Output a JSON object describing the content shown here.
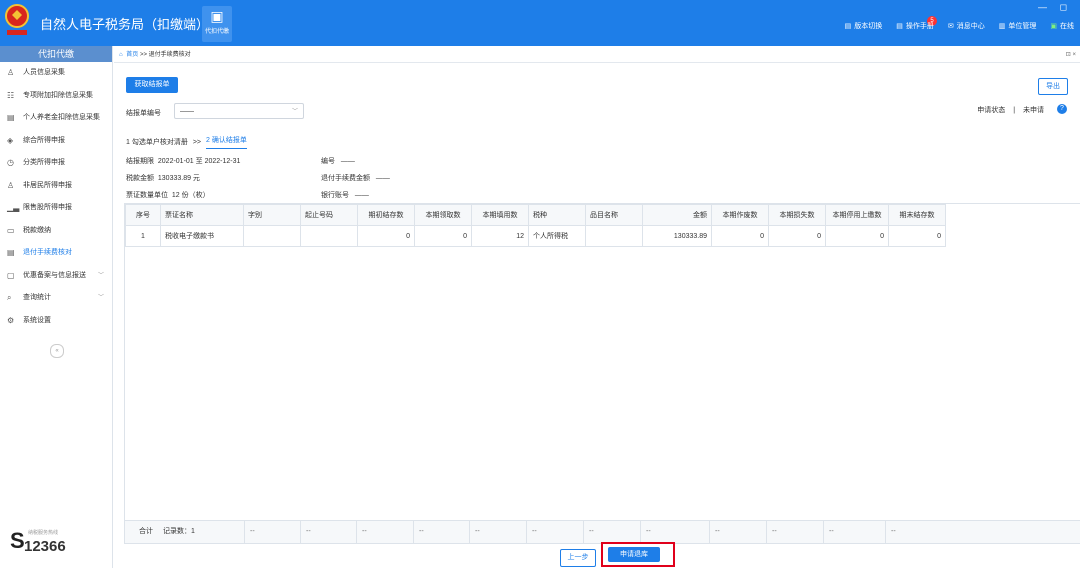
{
  "app": {
    "title": "自然人电子税务局（扣缴端）",
    "module_label": "代扣代缴",
    "module_icon": "wallet-icon",
    "window_controls": "— ◻",
    "toolbar": [
      {
        "label": "版本切换",
        "icon": "version-icon"
      },
      {
        "label": "操作手册",
        "icon": "manual-icon"
      },
      {
        "label": "消息中心",
        "icon": "message-icon"
      },
      {
        "label": "单位管理",
        "icon": "org-icon"
      },
      {
        "label": "在线",
        "icon": "online-icon"
      }
    ],
    "message_count": "5",
    "accent": "#1e7ee8",
    "highlight": "#e0001b"
  },
  "sidebar": {
    "header": "代扣代缴",
    "items": [
      {
        "label": "人员信息采集",
        "icon": "person-icon"
      },
      {
        "label": "专项附加扣除信息采集",
        "icon": "list-icon"
      },
      {
        "label": "个人养老金扣除信息采集",
        "icon": "card-icon"
      },
      {
        "label": "综合所得申报",
        "icon": "layers-icon"
      },
      {
        "label": "分类所得申报",
        "icon": "clock-icon"
      },
      {
        "label": "非居民所得申报",
        "icon": "user-globe-icon"
      },
      {
        "label": "限售股所得申报",
        "icon": "chart-icon"
      },
      {
        "label": "税款缴纳",
        "icon": "folder-icon"
      },
      {
        "label": "退付手续费核对",
        "icon": "document-icon"
      },
      {
        "label": "优惠备案与信息报送",
        "icon": "shield-icon"
      },
      {
        "label": "查询统计",
        "icon": "search-icon"
      },
      {
        "label": "系统设置",
        "icon": "gear-icon"
      }
    ],
    "collapse": "«",
    "hotline_label": "纳税服务热线",
    "hotline_number": "12366"
  },
  "breadcrumb": {
    "home": "首页",
    "sep": ">>",
    "current": "退付手续费核对",
    "close": "⊡ ×"
  },
  "main": {
    "get_report_btn": "获取结报单",
    "export_btn": "导出",
    "report_no_label": "结报单编号",
    "report_no_value": "——",
    "status_label": "申请状态",
    "status_sep": "|",
    "status_value": "未申请",
    "help": "?",
    "steps": {
      "step1": "1 勾选单户核对清册",
      "sep": ">>",
      "step2": "2 确认结报单"
    },
    "info": {
      "period_label": "结报期限",
      "period_value": "2022-01-01  至  2022-12-31",
      "amount_label": "税款金额",
      "amount_value": "130333.89 元",
      "unit_label": "票证数量单位",
      "unit_value": "12 份（枚）",
      "no_label": "编号",
      "no_value": "——",
      "fee_label": "退付手续费金额",
      "fee_value": "——",
      "bank_label": "银行账号",
      "bank_value": "——"
    },
    "table": {
      "headers": [
        "序号",
        "票证名称",
        "字别",
        "起止号码",
        "期初结存数",
        "本期领取数",
        "本期填用数",
        "税种",
        "品目名称",
        "金额",
        "本期作废数",
        "本期损失数",
        "本期停用上缴数",
        "期末结存数"
      ],
      "rows": [
        [
          "1",
          "税收电子缴款书",
          "",
          "",
          "0",
          "0",
          "12",
          "个人所得税",
          "",
          "130333.89",
          "0",
          "0",
          "0",
          "0"
        ]
      ],
      "footer": {
        "total_label": "合计",
        "count_label": "记录数：1",
        "dash": "--"
      }
    },
    "prev_btn": "上一步",
    "submit_btn": "申请退库"
  }
}
